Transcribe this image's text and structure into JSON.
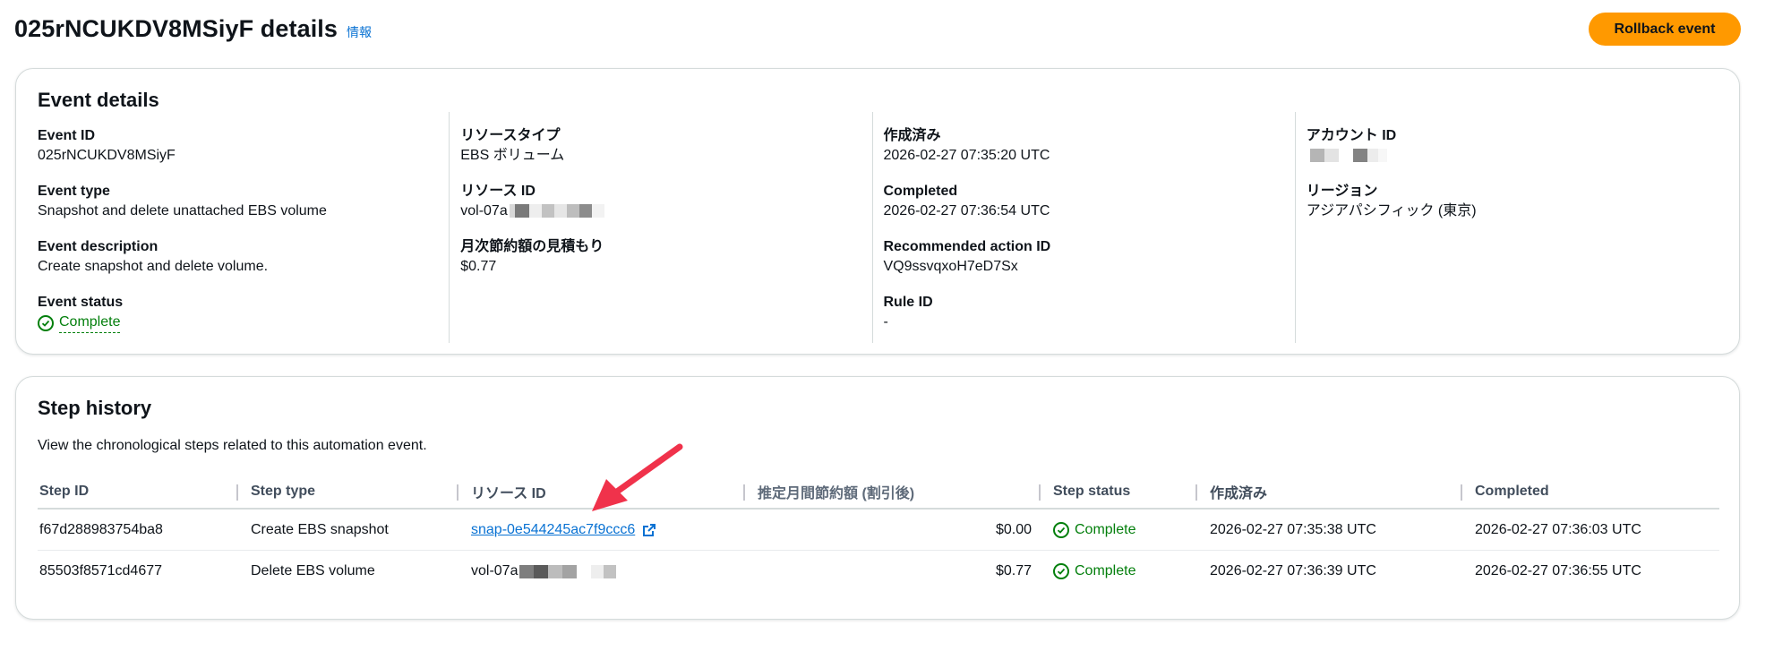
{
  "header": {
    "title": "025rNCUKDV8MSiyF details",
    "info": "情報",
    "rollback_label": "Rollback event"
  },
  "event_details": {
    "title": "Event details",
    "event_id_label": "Event ID",
    "event_id": "025rNCUKDV8MSiyF",
    "event_type_label": "Event type",
    "event_type": "Snapshot and delete unattached EBS volume",
    "event_description_label": "Event description",
    "event_description": "Create snapshot and delete volume.",
    "event_status_label": "Event status",
    "event_status": "Complete",
    "resource_type_label": "リソースタイプ",
    "resource_type": "EBS ボリューム",
    "resource_id_label": "リソース ID",
    "resource_id_prefix": "vol-07a",
    "monthly_savings_label": "月次節約額の見積もり",
    "monthly_savings": "$0.77",
    "created_label": "作成済み",
    "created": "2026-02-27 07:35:20 UTC",
    "completed_label": "Completed",
    "completed": "2026-02-27 07:36:54 UTC",
    "recommended_action_id_label": "Recommended action ID",
    "recommended_action_id": "VQ9ssvqxoH7eD7Sx",
    "rule_id_label": "Rule ID",
    "rule_id": "-",
    "account_id_label": "アカウント ID",
    "region_label": "リージョン",
    "region": "アジアパシフィック (東京)"
  },
  "step_history": {
    "title": "Step history",
    "description": "View the chronological steps related to this automation event.",
    "columns": [
      "Step ID",
      "Step type",
      "リソース ID",
      "推定月間節約額 (割引後)",
      "Step status",
      "作成済み",
      "Completed"
    ],
    "rows": [
      {
        "step_id": "f67d288983754ba8",
        "step_type": "Create EBS snapshot",
        "resource_id": "snap-0e544245ac7f9ccc6",
        "savings": "$0.00",
        "status": "Complete",
        "created": "2026-02-27 07:35:38 UTC",
        "completed": "2026-02-27 07:36:03 UTC"
      },
      {
        "step_id": "85503f8571cd4677",
        "step_type": "Delete EBS volume",
        "resource_id": "vol-07a",
        "savings": "$0.77",
        "status": "Complete",
        "created": "2026-02-27 07:36:39 UTC",
        "completed": "2026-02-27 07:36:55 UTC"
      }
    ]
  },
  "colors": {
    "accent": "#ff9900",
    "link": "#0972d3",
    "success": "#037f0c",
    "annotation_arrow": "#f0324b"
  },
  "icons": {
    "status": "check-circle-icon",
    "external": "external-link-icon"
  }
}
